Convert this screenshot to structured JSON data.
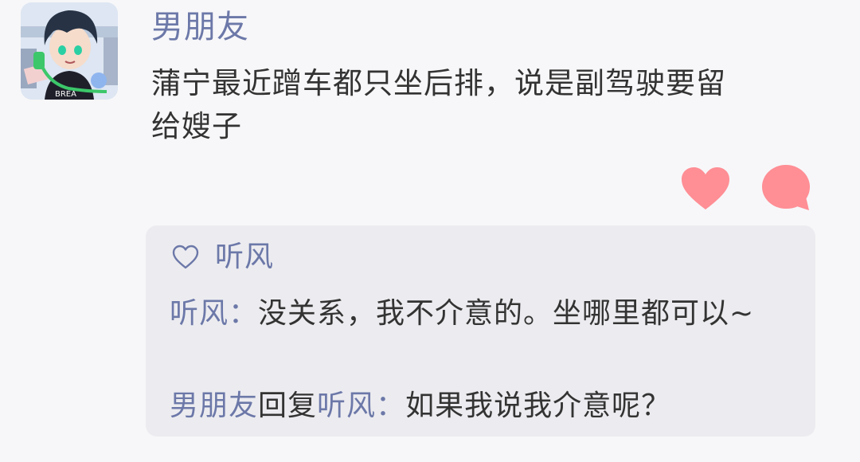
{
  "post": {
    "author": "男朋友",
    "content": "蒲宁最近蹭车都只坐后排，说是副驾驶要留\n给嫂子",
    "avatar_icon": "anime-boy-avatar-icon",
    "actions": {
      "like_icon": "heart-icon",
      "comment_icon": "speech-bubble-icon"
    }
  },
  "likes": {
    "icon": "heart-outline-icon",
    "names": "听风"
  },
  "comments": [
    {
      "author": "听风",
      "separator": "：",
      "text": "没关系，我不介意的。坐哪里都可以~"
    },
    {
      "author": "男朋友",
      "reply_word": "回复",
      "reply_to": "听风",
      "separator": "：",
      "text": "如果我说我介意呢？"
    }
  ],
  "colors": {
    "background": "#f7f7f9",
    "name": "#6c78a8",
    "text": "#333333",
    "accent": "#ff8e95",
    "panel": "#ececf0"
  }
}
